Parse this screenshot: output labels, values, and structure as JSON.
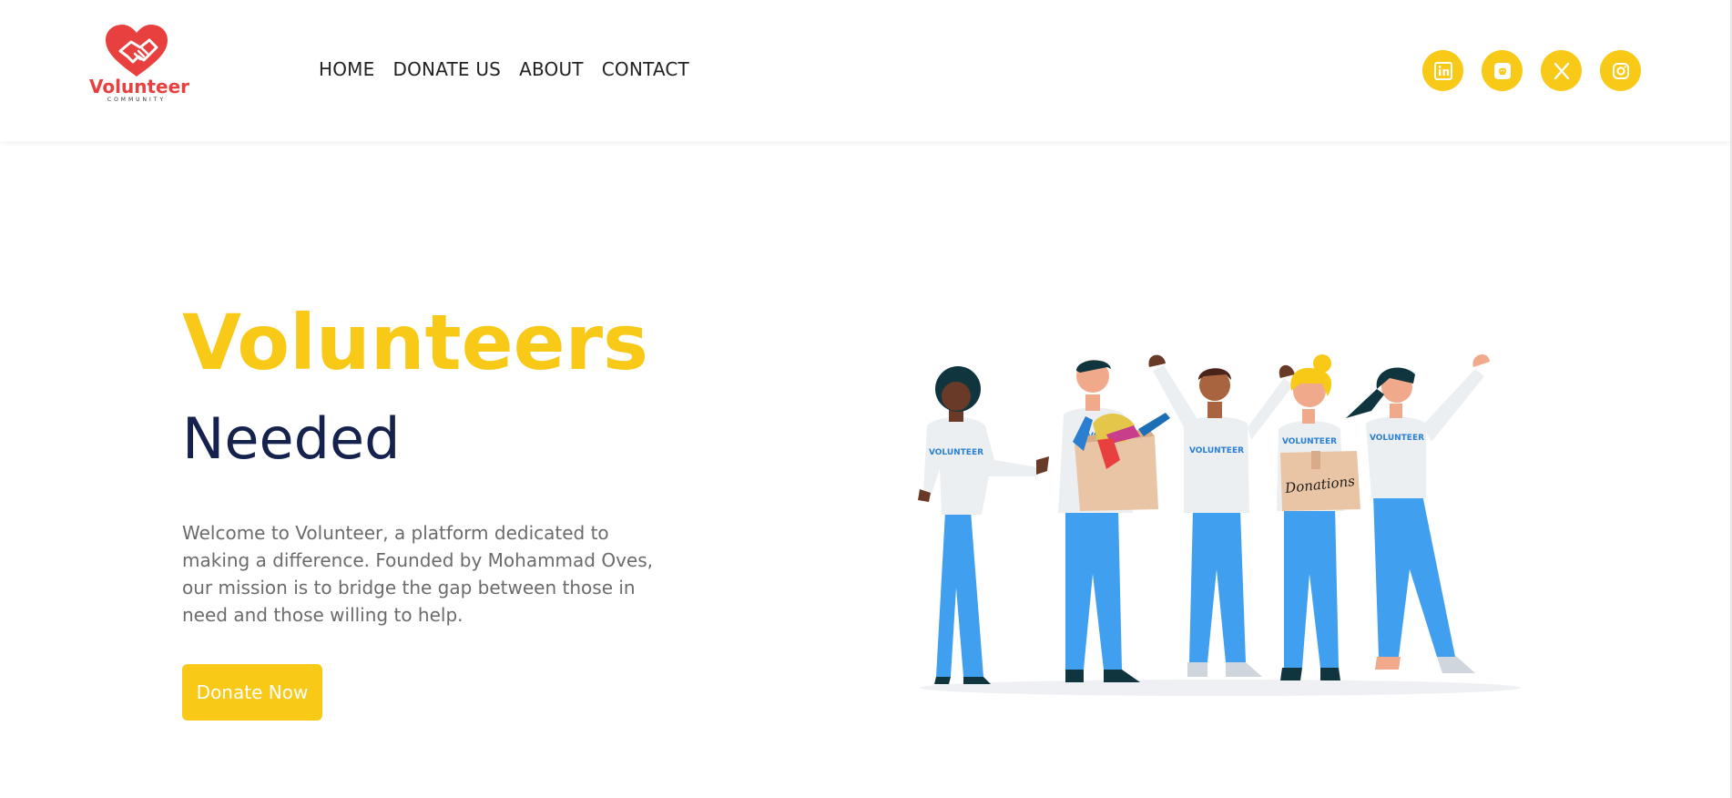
{
  "brand": {
    "name": "Volunteer",
    "tagline": "COMMUNITY",
    "color": "#e8403f",
    "icon": "heart-handshake-icon"
  },
  "nav": {
    "items": [
      {
        "label": "HOME"
      },
      {
        "label": "DONATE US"
      },
      {
        "label": "ABOUT"
      },
      {
        "label": "CONTACT"
      }
    ]
  },
  "social": {
    "color": "#f9c918",
    "items": [
      {
        "icon": "linkedin-icon"
      },
      {
        "icon": "github-icon"
      },
      {
        "icon": "x-twitter-icon"
      },
      {
        "icon": "instagram-icon"
      }
    ]
  },
  "hero": {
    "title": "Volunteers",
    "subtitle": "Needed",
    "description": "Welcome to Volunteer, a platform dedicated to making a difference. Founded by Mohammad Oves, our mission is to bridge the gap between those in need and those willing to help.",
    "cta_label": "Donate Now",
    "title_color": "#f9c918",
    "subtitle_color": "#16224e"
  },
  "illustration": {
    "shirt_label": "VOLUNTEER",
    "box_label": "Donations"
  }
}
